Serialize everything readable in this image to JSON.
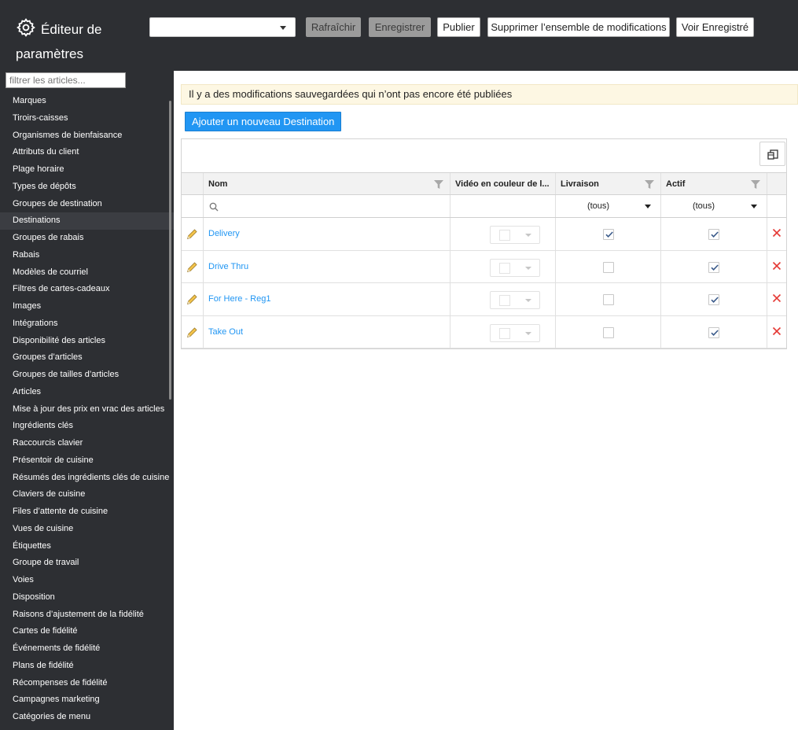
{
  "app": {
    "title": "Éditeur de paramètres"
  },
  "toolbar": {
    "changeset_select_value": "",
    "refresh_label": "Rafraîchir",
    "save_label": "Enregistrer",
    "publish_label": "Publier",
    "delete_changeset_label": "Supprimer l’ensemble de modifications",
    "view_saved_label": "Voir Enregistré"
  },
  "sidebar": {
    "filter_placeholder": "filtrer les articles...",
    "items": [
      {
        "label": "Marques"
      },
      {
        "label": "Tiroirs-caisses"
      },
      {
        "label": "Organismes de bienfaisance"
      },
      {
        "label": "Attributs du client"
      },
      {
        "label": "Plage horaire"
      },
      {
        "label": "Types de dépôts"
      },
      {
        "label": "Groupes de destination"
      },
      {
        "label": "Destinations",
        "active": true
      },
      {
        "label": "Groupes de rabais"
      },
      {
        "label": "Rabais"
      },
      {
        "label": "Modèles de courriel"
      },
      {
        "label": "Filtres de cartes-cadeaux"
      },
      {
        "label": "Images"
      },
      {
        "label": "Intégrations"
      },
      {
        "label": "Disponibilité des articles"
      },
      {
        "label": "Groupes d’articles"
      },
      {
        "label": "Groupes de tailles d’articles"
      },
      {
        "label": "Articles"
      },
      {
        "label": "Mise à jour des prix en vrac des articles"
      },
      {
        "label": "Ingrédients clés"
      },
      {
        "label": "Raccourcis clavier"
      },
      {
        "label": "Présentoir de cuisine"
      },
      {
        "label": "Résumés des ingrédients clés de cuisine"
      },
      {
        "label": "Claviers de cuisine"
      },
      {
        "label": "Files d’attente de cuisine"
      },
      {
        "label": "Vues de cuisine"
      },
      {
        "label": "Étiquettes"
      },
      {
        "label": "Groupe de travail"
      },
      {
        "label": "Voies"
      },
      {
        "label": "Disposition"
      },
      {
        "label": "Raisons d’ajustement de la fidélité"
      },
      {
        "label": "Cartes de fidélité"
      },
      {
        "label": "Événements de fidélité"
      },
      {
        "label": "Plans de fidélité"
      },
      {
        "label": "Récompenses de fidélité"
      },
      {
        "label": "Campagnes marketing"
      },
      {
        "label": "Catégories de menu"
      }
    ]
  },
  "main": {
    "notice": "Il y a des modifications sauvegardées qui n’ont pas encore été publiées",
    "add_button_label": "Ajouter un nouveau Destination",
    "grid": {
      "columns": {
        "name": "Nom",
        "video_color": "Vidéo en couleur de l...",
        "delivery": "Livraison",
        "active": "Actif"
      },
      "filters": {
        "delivery": "(tous)",
        "active": "(tous)"
      },
      "rows": [
        {
          "name": "Delivery",
          "delivery": true,
          "active": true
        },
        {
          "name": "Drive Thru",
          "delivery": false,
          "active": true
        },
        {
          "name": "For Here - Reg1",
          "delivery": false,
          "active": true
        },
        {
          "name": "Take Out",
          "delivery": false,
          "active": true
        }
      ]
    }
  },
  "colors": {
    "header_bg": "#2d2f33",
    "accent": "#2196f3",
    "delete": "#e53935",
    "notice_bg": "#fdf7e3"
  },
  "icons": {
    "title": "gear-icon",
    "column_chooser": "column-chooser-icon",
    "column_filter": "funnel-icon",
    "search": "search-icon",
    "edit": "pencil-icon",
    "delete": "close-icon"
  }
}
